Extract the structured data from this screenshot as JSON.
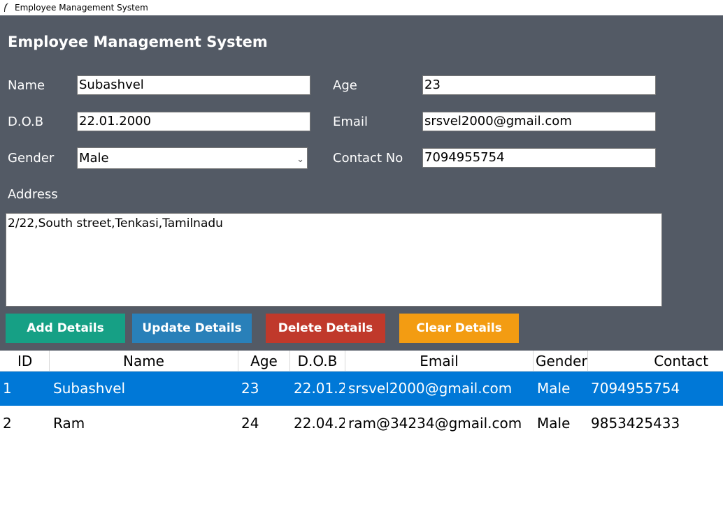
{
  "window": {
    "title": "Employee Management System"
  },
  "form": {
    "heading": "Employee Management System",
    "name_label": "Name",
    "name_value": "Subashvel",
    "age_label": "Age",
    "age_value": "23",
    "dob_label": "D.O.B",
    "dob_value": "22.01.2000",
    "email_label": "Email",
    "email_value": "srsvel2000@gmail.com",
    "gender_label": "Gender",
    "gender_value": "Male",
    "contact_label": "Contact No",
    "contact_value": "7094955754",
    "address_label": "Address",
    "address_value": "2/22,South street,Tenkasi,Tamilnadu"
  },
  "buttons": {
    "add": "Add Details",
    "update": "Update Details",
    "delete": "Delete Details",
    "clear": "Clear Details"
  },
  "colors": {
    "form_bg": "#535a65",
    "add": "#16a085",
    "update": "#2980b9",
    "delete": "#c0392b",
    "clear": "#f39c12",
    "selection": "#0078d7"
  },
  "table": {
    "columns": [
      "ID",
      "Name",
      "Age",
      "D.O.B",
      "Email",
      "Gender",
      "Contact"
    ],
    "rows": [
      [
        "1",
        "Subashvel",
        "23",
        "22.01.2",
        "srsvel2000@gmail.com",
        "Male",
        "7094955754"
      ],
      [
        "2",
        "Ram",
        "24",
        "22.04.2",
        "ram@34234@gmail.com",
        "Male",
        "9853425433"
      ]
    ]
  }
}
